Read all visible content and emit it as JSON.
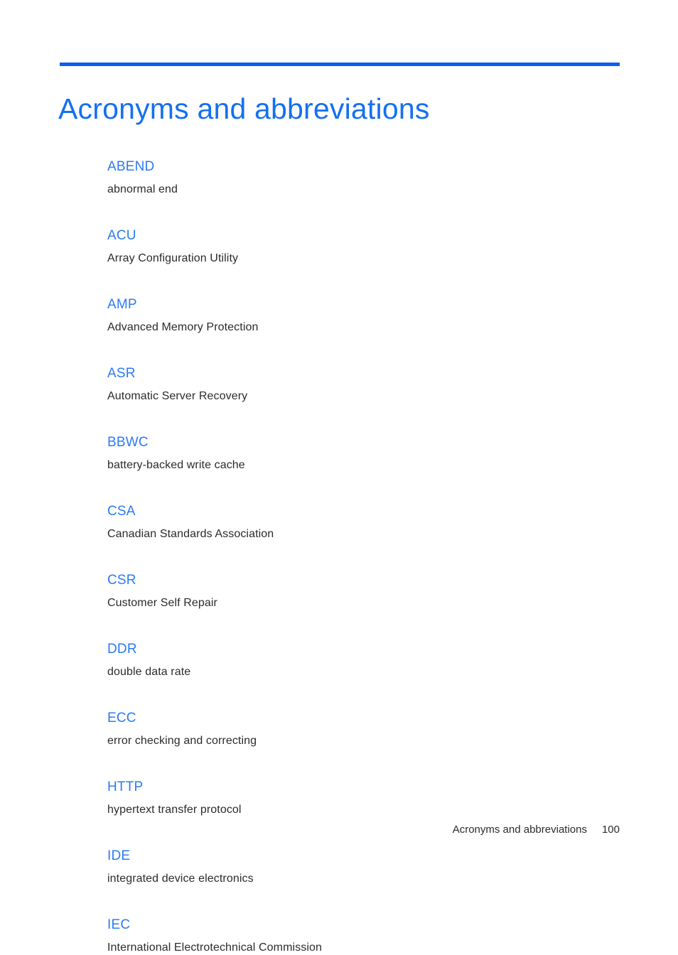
{
  "document": {
    "title": "Acronyms and abbreviations",
    "accent_rule_color": "#0a5ef0",
    "title_color": "#1470f0",
    "term_color": "#2b7bf0",
    "definition_color": "#2b2b2b"
  },
  "glossary": {
    "entries": [
      {
        "term": "ABEND",
        "definition": "abnormal end"
      },
      {
        "term": "ACU",
        "definition": "Array Configuration Utility"
      },
      {
        "term": "AMP",
        "definition": "Advanced Memory Protection"
      },
      {
        "term": "ASR",
        "definition": "Automatic Server Recovery"
      },
      {
        "term": "BBWC",
        "definition": "battery-backed write cache"
      },
      {
        "term": "CSA",
        "definition": "Canadian Standards Association"
      },
      {
        "term": "CSR",
        "definition": "Customer Self Repair"
      },
      {
        "term": "DDR",
        "definition": "double data rate"
      },
      {
        "term": "ECC",
        "definition": "error checking and correcting"
      },
      {
        "term": "HTTP",
        "definition": "hypertext transfer protocol"
      },
      {
        "term": "IDE",
        "definition": "integrated device electronics"
      },
      {
        "term": "IEC",
        "definition": "International Electrotechnical Commission"
      }
    ]
  },
  "footer": {
    "section_title": "Acronyms and abbreviations",
    "page_number": "100"
  }
}
